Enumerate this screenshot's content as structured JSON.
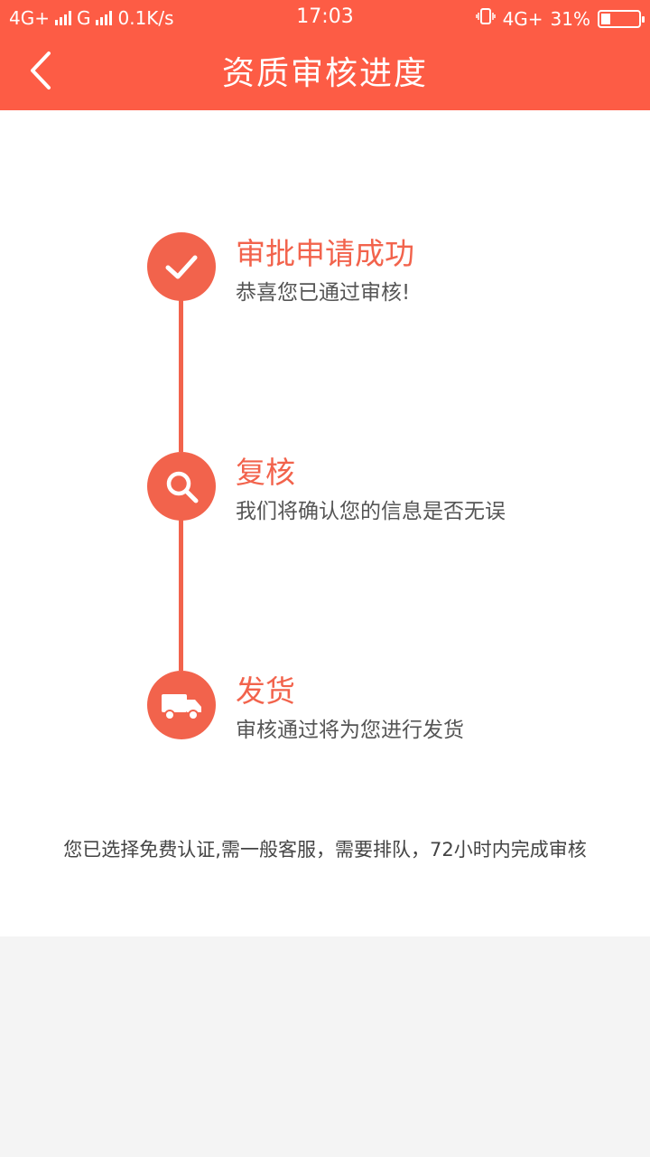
{
  "status_bar": {
    "network1": "4G+",
    "network2": "G",
    "speed": "0.1K/s",
    "time": "17:03",
    "network3": "4G+",
    "battery": "31%",
    "battery_level": 0.31
  },
  "header": {
    "title": "资质审核进度",
    "back_icon": "chevron-left-icon"
  },
  "steps": [
    {
      "icon": "check-icon",
      "title": "审批申请成功",
      "desc": "恭喜您已通过审核!"
    },
    {
      "icon": "search-icon",
      "title": "复核",
      "desc": "我们将确认您的信息是否无误"
    },
    {
      "icon": "truck-icon",
      "title": "发货",
      "desc": "审核通过将为您进行发货"
    }
  ],
  "note": "您已选择免费认证,需一般客服，需要排队，72小时内完成审核",
  "colors": {
    "header_bg": "#fd5c45",
    "accent": "#f2634c",
    "page_bg": "#f4f4f4"
  }
}
